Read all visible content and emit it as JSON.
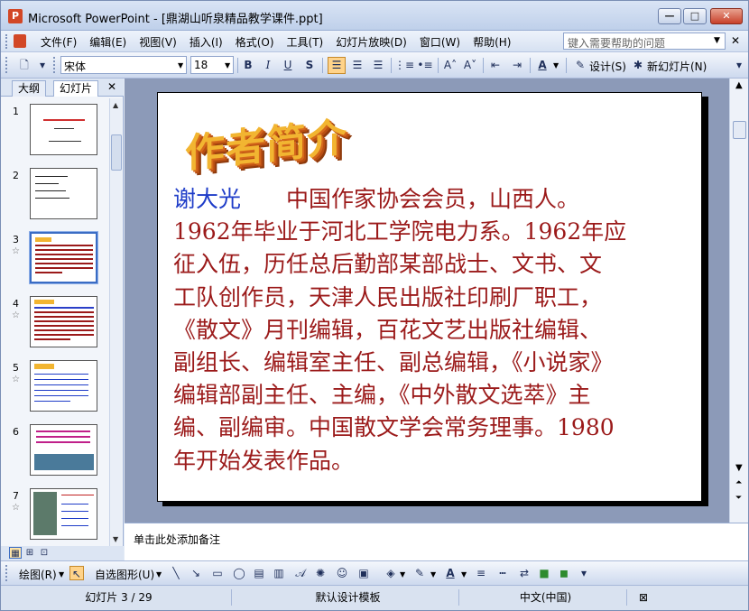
{
  "window": {
    "title": "Microsoft PowerPoint - [鼎湖山听泉精品教学课件.ppt]",
    "min_icon": "minimize-icon",
    "max_icon": "maximize-icon",
    "close_icon": "close-icon"
  },
  "menu": {
    "items": [
      "文件(F)",
      "编辑(E)",
      "视图(V)",
      "插入(I)",
      "格式(O)",
      "工具(T)",
      "幻灯片放映(D)",
      "窗口(W)",
      "帮助(H)"
    ],
    "help_placeholder": "键入需要帮助的问题"
  },
  "toolbar": {
    "font": "宋体",
    "size": "18",
    "bold": "B",
    "italic": "I",
    "underline": "U",
    "shadow": "S",
    "design_label": "设计(S)",
    "new_slide_label": "新幻灯片(N)"
  },
  "left_pane": {
    "tab_outline": "大纲",
    "tab_slides": "幻灯片",
    "thumbnails": [
      {
        "num": "1",
        "star": false
      },
      {
        "num": "2",
        "star": false
      },
      {
        "num": "3",
        "star": true
      },
      {
        "num": "4",
        "star": true
      },
      {
        "num": "5",
        "star": true
      },
      {
        "num": "6",
        "star": false
      },
      {
        "num": "7",
        "star": true
      }
    ],
    "selected_index": 2
  },
  "slide": {
    "wordart_title": "作者简介",
    "author_name": "谢大光",
    "body_lines": [
      "　　中国作家协会会员，山西人。",
      "1962年毕业于河北工学院电力系。1962年应",
      "征入伍，历任总后勤部某部战士、文书、文",
      "工队创作员，天津人民出版社印刷厂职工，",
      "《散文》月刊编辑，百花文艺出版社编辑、",
      "副组长、编辑室主任、副总编辑，《小说家》",
      "编辑部副主任、主编，《中外散文选萃》主",
      "编、副编审。中国散文学会常务理事。1980",
      "年开始发表作品。"
    ]
  },
  "notes": {
    "placeholder": "单击此处添加备注"
  },
  "drawing_toolbar": {
    "draw_label": "绘图(R)",
    "autoshapes_label": "自选图形(U)"
  },
  "status": {
    "slide_info": "幻灯片 3 / 29",
    "template": "默认设计模板",
    "language": "中文(中国)"
  }
}
